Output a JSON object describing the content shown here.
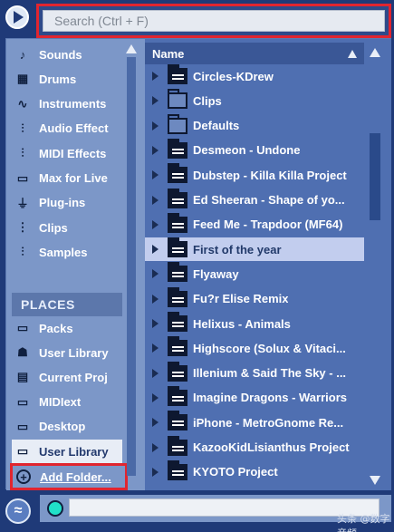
{
  "search": {
    "placeholder": "Search (Ctrl + F)",
    "value": ""
  },
  "categories": [
    {
      "label": "Sounds",
      "icon": "note-icon"
    },
    {
      "label": "Drums",
      "icon": "grid-icon"
    },
    {
      "label": "Instruments",
      "icon": "wave-icon"
    },
    {
      "label": "Audio Effect",
      "icon": "audio-effect-icon"
    },
    {
      "label": "MIDI Effects",
      "icon": "midi-effect-icon"
    },
    {
      "label": "Max for Live",
      "icon": "max-icon"
    },
    {
      "label": "Plug-ins",
      "icon": "plug-icon"
    },
    {
      "label": "Clips",
      "icon": "clip-icon"
    },
    {
      "label": "Samples",
      "icon": "sample-icon"
    }
  ],
  "places": {
    "header": "PLACES",
    "items": [
      {
        "label": "Packs",
        "icon": "packs-icon"
      },
      {
        "label": "User Library",
        "icon": "user-icon"
      },
      {
        "label": "Current Proj",
        "icon": "project-icon"
      },
      {
        "label": "MIDIext",
        "icon": "folder-icon"
      },
      {
        "label": "Desktop",
        "icon": "folder-icon"
      },
      {
        "label": "User Library",
        "icon": "folder-icon"
      }
    ],
    "selected_index": 5,
    "add_folder_label": "Add Folder..."
  },
  "file_list": {
    "column_header": "Name",
    "selected_index": 7,
    "items": [
      {
        "name": "Circles-KDrew",
        "type": "project"
      },
      {
        "name": "Clips",
        "type": "folder"
      },
      {
        "name": "Defaults",
        "type": "folder"
      },
      {
        "name": "Desmeon - Undone",
        "type": "project"
      },
      {
        "name": "Dubstep - Killa Killa Project",
        "type": "project"
      },
      {
        "name": "Ed Sheeran - Shape of yo...",
        "type": "project"
      },
      {
        "name": "Feed Me - Trapdoor (MF64)",
        "type": "project"
      },
      {
        "name": "First of the year",
        "type": "project"
      },
      {
        "name": "Flyaway",
        "type": "project"
      },
      {
        "name": "Fu?r Elise Remix",
        "type": "project"
      },
      {
        "name": "Helixus - Animals",
        "type": "project"
      },
      {
        "name": "Highscore (Solux & Vitaci...",
        "type": "project"
      },
      {
        "name": "Illenium & Said The Sky - ...",
        "type": "project"
      },
      {
        "name": "Imagine Dragons - Warriors",
        "type": "project"
      },
      {
        "name": "iPhone - MetroGnome Re...",
        "type": "project"
      },
      {
        "name": "KazooKidLisianthus Project",
        "type": "project"
      },
      {
        "name": "KYOTO Project",
        "type": "project"
      }
    ]
  },
  "watermark": "头条 @数字音频"
}
